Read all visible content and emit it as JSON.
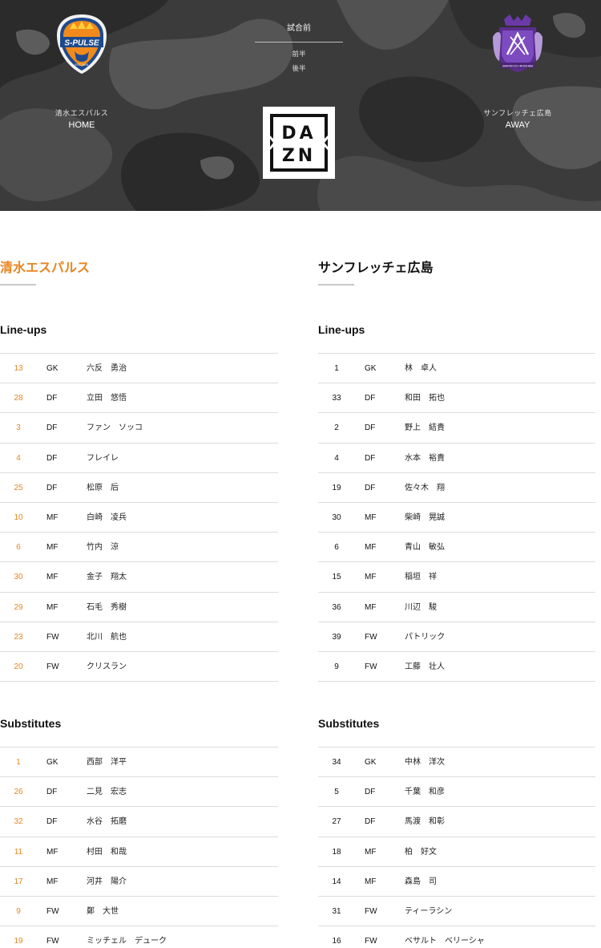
{
  "match": {
    "status": "試合前",
    "first_half": "前半",
    "second_half": "後半"
  },
  "home": {
    "name": "清水エスパルス",
    "side": "HOME",
    "crest_text": "S-PULSE",
    "color": "#e98521"
  },
  "away": {
    "name": "サンフレッチェ広島",
    "side": "AWAY",
    "crest_text": "SANFRECCE HIROSHIMA",
    "color": "#5b2d8e"
  },
  "broadcaster": {
    "logo_text": "DAZN"
  },
  "sections": {
    "lineups": "Line-ups",
    "substitutes": "Substitutes"
  },
  "home_lineup": [
    {
      "num": "13",
      "pos": "GK",
      "name": "六反　勇治"
    },
    {
      "num": "28",
      "pos": "DF",
      "name": "立田　悠悟"
    },
    {
      "num": "3",
      "pos": "DF",
      "name": "ファン　ソッコ"
    },
    {
      "num": "4",
      "pos": "DF",
      "name": "フレイレ"
    },
    {
      "num": "25",
      "pos": "DF",
      "name": "松原　后"
    },
    {
      "num": "10",
      "pos": "MF",
      "name": "白崎　凌兵"
    },
    {
      "num": "6",
      "pos": "MF",
      "name": "竹内　涼"
    },
    {
      "num": "30",
      "pos": "MF",
      "name": "金子　翔太"
    },
    {
      "num": "29",
      "pos": "MF",
      "name": "石毛　秀樹"
    },
    {
      "num": "23",
      "pos": "FW",
      "name": "北川　航也"
    },
    {
      "num": "20",
      "pos": "FW",
      "name": "クリスラン"
    }
  ],
  "away_lineup": [
    {
      "num": "1",
      "pos": "GK",
      "name": "林　卓人"
    },
    {
      "num": "33",
      "pos": "DF",
      "name": "和田　拓也"
    },
    {
      "num": "2",
      "pos": "DF",
      "name": "野上　結貴"
    },
    {
      "num": "4",
      "pos": "DF",
      "name": "水本　裕貴"
    },
    {
      "num": "19",
      "pos": "DF",
      "name": "佐々木　翔"
    },
    {
      "num": "30",
      "pos": "MF",
      "name": "柴崎　晃誠"
    },
    {
      "num": "6",
      "pos": "MF",
      "name": "青山　敏弘"
    },
    {
      "num": "15",
      "pos": "MF",
      "name": "稲垣　祥"
    },
    {
      "num": "36",
      "pos": "MF",
      "name": "川辺　駿"
    },
    {
      "num": "39",
      "pos": "FW",
      "name": "パトリック"
    },
    {
      "num": "9",
      "pos": "FW",
      "name": "工藤　壮人"
    }
  ],
  "home_subs": [
    {
      "num": "1",
      "pos": "GK",
      "name": "西部　洋平"
    },
    {
      "num": "26",
      "pos": "DF",
      "name": "二見　宏志"
    },
    {
      "num": "32",
      "pos": "DF",
      "name": "水谷　拓磨"
    },
    {
      "num": "11",
      "pos": "MF",
      "name": "村田　和哉"
    },
    {
      "num": "17",
      "pos": "MF",
      "name": "河井　陽介"
    },
    {
      "num": "9",
      "pos": "FW",
      "name": "鄭　大世"
    },
    {
      "num": "19",
      "pos": "FW",
      "name": "ミッチェル　デューク"
    }
  ],
  "away_subs": [
    {
      "num": "34",
      "pos": "GK",
      "name": "中林　洋次"
    },
    {
      "num": "5",
      "pos": "DF",
      "name": "千葉　和彦"
    },
    {
      "num": "27",
      "pos": "DF",
      "name": "馬渡　和彰"
    },
    {
      "num": "18",
      "pos": "MF",
      "name": "柏　好文"
    },
    {
      "num": "14",
      "pos": "MF",
      "name": "森島　司"
    },
    {
      "num": "31",
      "pos": "FW",
      "name": "ティーラシン"
    },
    {
      "num": "16",
      "pos": "FW",
      "name": "ベサルト　ベリーシャ"
    }
  ]
}
